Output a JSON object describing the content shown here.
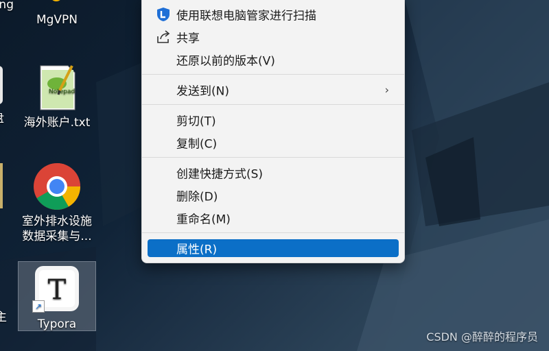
{
  "desktop": {
    "icons": [
      {
        "label": "ng"
      },
      {
        "label": "MgVPN"
      },
      {
        "label": "盘"
      },
      {
        "label": "海外账户.txt"
      },
      {
        "label_line1": "室外排水设施",
        "label_line2": "数据采集与..."
      },
      {
        "label": "主"
      },
      {
        "label": "Typora"
      }
    ]
  },
  "context_menu": {
    "items": [
      {
        "label": "使用联想电脑管家进行扫描",
        "icon": "lenovo-shield-icon"
      },
      {
        "label": "共享",
        "icon": "share-icon"
      },
      {
        "label": "还原以前的版本(V)"
      },
      {
        "label": "发送到(N)",
        "submenu": "chevron-right-icon"
      },
      {
        "label": "剪切(T)"
      },
      {
        "label": "复制(C)"
      },
      {
        "label": "创建快捷方式(S)"
      },
      {
        "label": "删除(D)"
      },
      {
        "label": "重命名(M)"
      },
      {
        "label": "属性(R)",
        "highlighted": true
      }
    ],
    "highlight_color": "#0b6fc7"
  },
  "watermark": "CSDN @醉醉的程序员"
}
